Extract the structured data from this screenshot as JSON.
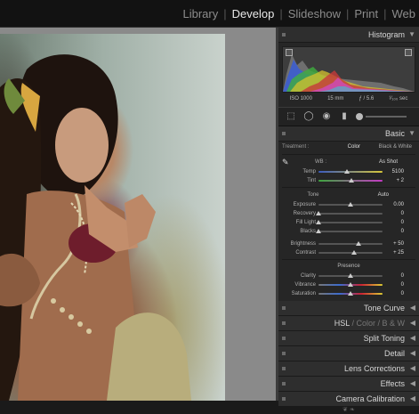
{
  "modules": {
    "library": "Library",
    "develop": "Develop",
    "slideshow": "Slideshow",
    "print": "Print",
    "web": "Web",
    "separator": "|"
  },
  "histogram": {
    "title": "Histogram",
    "iso": "ISO 1000",
    "focal": "15 mm",
    "aperture": "ƒ / 5.6",
    "shutter": "¹⁄₁₀₀ sec"
  },
  "basic": {
    "title": "Basic",
    "treatment_label": "Treatment :",
    "color_label": "Color",
    "bw_label": "Black & White",
    "wb_label": "WB :",
    "wb_value": "As Shot",
    "temp": {
      "label": "Temp",
      "value": "5100",
      "pos": 0.45
    },
    "tint": {
      "label": "Tint",
      "value": "+ 2",
      "pos": 0.51
    },
    "tone_label": "Tone",
    "auto_label": "Auto",
    "exposure": {
      "label": "Exposure",
      "value": "0.00",
      "pos": 0.5
    },
    "recovery": {
      "label": "Recovery",
      "value": "0",
      "pos": 0.0
    },
    "fill_light": {
      "label": "Fill Light",
      "value": "0",
      "pos": 0.0
    },
    "blacks": {
      "label": "Blacks",
      "value": "0",
      "pos": 0.0
    },
    "brightness": {
      "label": "Brightness",
      "value": "+ 50",
      "pos": 0.62
    },
    "contrast": {
      "label": "Contrast",
      "value": "+ 25",
      "pos": 0.56
    },
    "presence_label": "Presence",
    "clarity": {
      "label": "Clarity",
      "value": "0",
      "pos": 0.5
    },
    "vibrance": {
      "label": "Vibrance",
      "value": "0",
      "pos": 0.5
    },
    "saturation": {
      "label": "Saturation",
      "value": "0",
      "pos": 0.5
    }
  },
  "panels": {
    "tone_curve": "Tone Curve",
    "hsl": "HSL",
    "color": "Color",
    "bw": "B & W",
    "split_toning": "Split Toning",
    "detail": "Detail",
    "lens_corrections": "Lens Corrections",
    "effects": "Effects",
    "camera_calibration": "Camera Calibration"
  },
  "icons": {
    "collapse": "◀",
    "expand": "▼"
  }
}
